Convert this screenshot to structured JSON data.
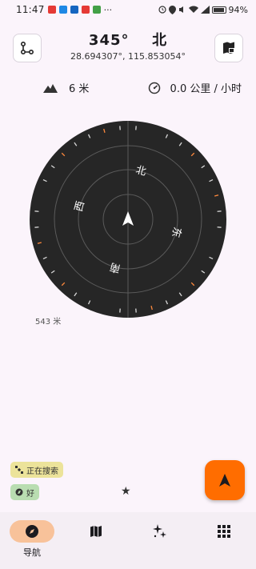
{
  "status_bar": {
    "time": "11:47",
    "more": "···",
    "battery_pct": "94%"
  },
  "header": {
    "heading": "345°",
    "direction": "北",
    "coordinates": "28.694307°, 115.853054°",
    "route_icon": "route-icon",
    "map_layers_icon": "map-layers-icon"
  },
  "info": {
    "altitude": "6 米",
    "speed": "0.0 公里 / 小时",
    "altitude_icon": "mountain-icon",
    "speed_icon": "speedometer-icon"
  },
  "compass": {
    "north": "北",
    "east": "东",
    "south": "南",
    "west": "西",
    "rotation_deg": 345
  },
  "range_label": "543 米",
  "status_chips": {
    "gps": "正在搜索",
    "signal": "好"
  },
  "star_label": "★",
  "nav": [
    {
      "label": "导航",
      "icon": "compass-icon",
      "active": true
    },
    {
      "label": "",
      "icon": "map-icon",
      "active": false
    },
    {
      "label": "",
      "icon": "sparkle-icon",
      "active": false
    },
    {
      "label": "",
      "icon": "grid-icon",
      "active": false
    }
  ],
  "colors": {
    "accent": "#ff6d00",
    "dial": "#262626",
    "nav_active": "#f8c29a"
  }
}
